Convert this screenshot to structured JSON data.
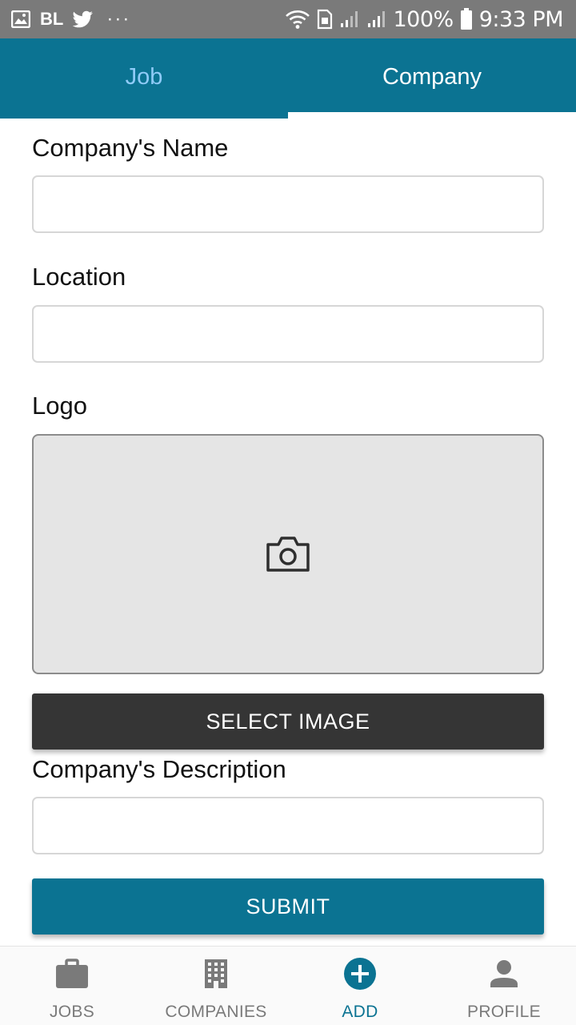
{
  "status_bar": {
    "carrier_text": "BL",
    "overflow_dots": "···",
    "battery": "100%",
    "time": "9:33 PM",
    "icons": [
      "image-icon",
      "twitter-icon",
      "wifi-icon",
      "sim-icon",
      "signal-icon",
      "signal-icon",
      "battery-icon"
    ]
  },
  "tabs": [
    {
      "label": "Job",
      "active": false
    },
    {
      "label": "Company",
      "active": true
    }
  ],
  "form": {
    "company_name": {
      "label": "Company's Name",
      "value": ""
    },
    "location": {
      "label": "Location",
      "value": ""
    },
    "logo": {
      "label": "Logo",
      "placeholder_icon": "camera-icon"
    },
    "select_image_label": "SELECT IMAGE",
    "description": {
      "label": "Company's Description",
      "value": ""
    },
    "submit_label": "SUBMIT"
  },
  "bottom_nav": [
    {
      "label": "JOBS",
      "icon": "briefcase-icon",
      "active": false
    },
    {
      "label": "COMPANIES",
      "icon": "building-icon",
      "active": false
    },
    {
      "label": "ADD",
      "icon": "add-circle-icon",
      "active": true
    },
    {
      "label": "PROFILE",
      "icon": "person-icon",
      "active": false
    }
  ],
  "colors": {
    "primary": "#0b7392",
    "status_bar": "#7a7a7a",
    "inactive_tab_text": "#8fcbf7",
    "select_button": "#353535",
    "logo_placeholder_bg": "#e5e5e5",
    "nav_inactive": "#7a7a7a"
  }
}
